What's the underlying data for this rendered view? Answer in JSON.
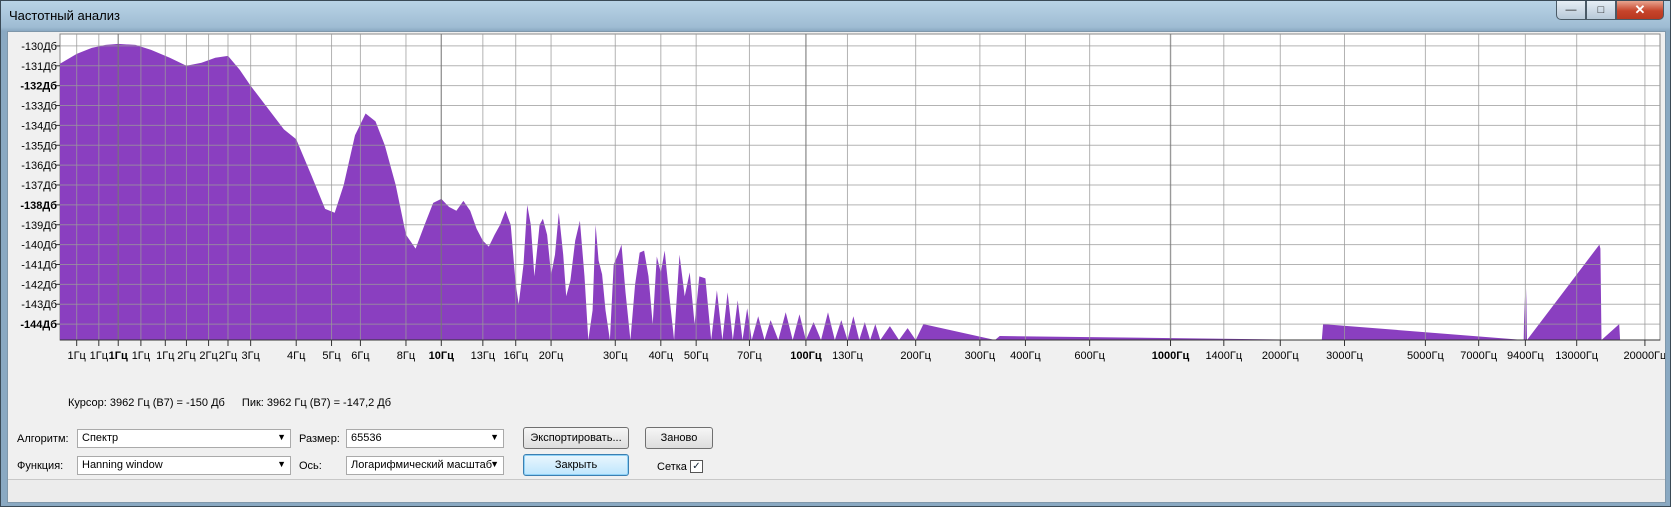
{
  "window": {
    "title": "Частотный анализ",
    "close_glyph": "✕",
    "min_glyph": "—",
    "max_glyph": "□"
  },
  "chart_data": {
    "type": "area",
    "fill_color": "#8a3fc0",
    "grid": true,
    "x_scale": "log",
    "xlim": [
      0.9,
      22000
    ],
    "ylim": [
      -144.8,
      -129.4
    ],
    "y_ticks": [
      {
        "v": -130,
        "label": "-130Дб",
        "bold": false
      },
      {
        "v": -131,
        "label": "-131Дб",
        "bold": false
      },
      {
        "v": -132,
        "label": "-132Дб",
        "bold": true
      },
      {
        "v": -133,
        "label": "-133Дб",
        "bold": false
      },
      {
        "v": -134,
        "label": "-134Дб",
        "bold": false
      },
      {
        "v": -135,
        "label": "-135Дб",
        "bold": false
      },
      {
        "v": -136,
        "label": "-136Дб",
        "bold": false
      },
      {
        "v": -137,
        "label": "-137Дб",
        "bold": false
      },
      {
        "v": -138,
        "label": "-138Дб",
        "bold": true
      },
      {
        "v": -139,
        "label": "-139Дб",
        "bold": false
      },
      {
        "v": -140,
        "label": "-140Дб",
        "bold": false
      },
      {
        "v": -141,
        "label": "-141Дб",
        "bold": false
      },
      {
        "v": -142,
        "label": "-142Дб",
        "bold": false
      },
      {
        "v": -143,
        "label": "-143Дб",
        "bold": false
      },
      {
        "v": -144,
        "label": "-144Дб",
        "bold": true
      }
    ],
    "x_ticks": [
      {
        "v": 1,
        "label": "1Гц",
        "bold": false
      },
      {
        "v": 1.15,
        "label": "1Гц",
        "bold": false
      },
      {
        "v": 1.3,
        "label": "1Гц",
        "bold": true
      },
      {
        "v": 1.5,
        "label": "1Гц",
        "bold": false
      },
      {
        "v": 1.75,
        "label": "1Гц",
        "bold": false
      },
      {
        "v": 2,
        "label": "2Гц",
        "bold": false
      },
      {
        "v": 2.3,
        "label": "2Гц",
        "bold": false
      },
      {
        "v": 2.6,
        "label": "2Гц",
        "bold": false
      },
      {
        "v": 3,
        "label": "3Гц",
        "bold": false
      },
      {
        "v": 4,
        "label": "4Гц",
        "bold": false
      },
      {
        "v": 5,
        "label": "5Гц",
        "bold": false
      },
      {
        "v": 6,
        "label": "6Гц",
        "bold": false
      },
      {
        "v": 8,
        "label": "8Гц",
        "bold": false
      },
      {
        "v": 10,
        "label": "10Гц",
        "bold": true
      },
      {
        "v": 13,
        "label": "13Гц",
        "bold": false
      },
      {
        "v": 16,
        "label": "16Гц",
        "bold": false
      },
      {
        "v": 20,
        "label": "20Гц",
        "bold": false
      },
      {
        "v": 30,
        "label": "30Гц",
        "bold": false
      },
      {
        "v": 40,
        "label": "40Гц",
        "bold": false
      },
      {
        "v": 50,
        "label": "50Гц",
        "bold": false
      },
      {
        "v": 70,
        "label": "70Гц",
        "bold": false
      },
      {
        "v": 100,
        "label": "100Гц",
        "bold": true
      },
      {
        "v": 130,
        "label": "130Гц",
        "bold": false
      },
      {
        "v": 200,
        "label": "200Гц",
        "bold": false
      },
      {
        "v": 300,
        "label": "300Гц",
        "bold": false
      },
      {
        "v": 400,
        "label": "400Гц",
        "bold": false
      },
      {
        "v": 600,
        "label": "600Гц",
        "bold": false
      },
      {
        "v": 1000,
        "label": "1000Гц",
        "bold": true
      },
      {
        "v": 1400,
        "label": "1400Гц",
        "bold": false
      },
      {
        "v": 2000,
        "label": "2000Гц",
        "bold": false
      },
      {
        "v": 3000,
        "label": "3000Гц",
        "bold": false
      },
      {
        "v": 5000,
        "label": "5000Гц",
        "bold": false
      },
      {
        "v": 7000,
        "label": "7000Гц",
        "bold": false
      },
      {
        "v": 9400,
        "label": "9400Гц",
        "bold": false
      },
      {
        "v": 13000,
        "label": "13000Гц",
        "bold": false
      },
      {
        "v": 20000,
        "label": "20000Гц",
        "bold": false
      }
    ],
    "series": [
      {
        "x": [
          0.9,
          1.0,
          1.1,
          1.2,
          1.3,
          1.45,
          1.6,
          1.8,
          2.0,
          2.2,
          2.4,
          2.6,
          2.8,
          3.0,
          3.3,
          3.7,
          4.0,
          4.4,
          4.8,
          5.1,
          5.4,
          5.8,
          6.2,
          6.6,
          7.0,
          7.5,
          8.0,
          8.5,
          9.0,
          9.5,
          10.0,
          10.5,
          11.0,
          11.5,
          12.0,
          12.5,
          13.0,
          13.5,
          14.0,
          14.5,
          15.0,
          15.5,
          16.0,
          16.3,
          16.8,
          17.2,
          17.6,
          18.0,
          18.6,
          19.0,
          19.5,
          20.0,
          20.5,
          21.0,
          21.6,
          22.0,
          22.6,
          23.3,
          24.0,
          24.7,
          25.3,
          26.0,
          26.5,
          27.0,
          27.6,
          28.2,
          29.0,
          29.7,
          30.5,
          31.2,
          32.0,
          33.0,
          34.0,
          35.0,
          36.0,
          37.0,
          38.0,
          39.0,
          40.0,
          41.0,
          42.0,
          43.5,
          45.0,
          46.5,
          48.0,
          49.5,
          51.0,
          53.0,
          55.0,
          57.0,
          59.0,
          61.0,
          63.0,
          65.0,
          67.0,
          69.0,
          71.0,
          74.0,
          77.0,
          80.0,
          84.0,
          88.0,
          92.0,
          96.0,
          100,
          105,
          110,
          115,
          120,
          125,
          130,
          135,
          140,
          145,
          150,
          155,
          160,
          170,
          180,
          190,
          200,
          210,
          330,
          340,
          2600,
          2620,
          9300,
          9350,
          9400,
          9450,
          9500,
          15000,
          15100,
          15200,
          17000,
          17100
        ],
        "y": [
          -130.9,
          -130.4,
          -130.1,
          -129.95,
          -129.9,
          -129.95,
          -130.2,
          -130.6,
          -131.0,
          -130.85,
          -130.6,
          -130.5,
          -131.2,
          -132.0,
          -133.0,
          -134.2,
          -134.7,
          -136.5,
          -138.2,
          -138.4,
          -137.0,
          -134.5,
          -133.4,
          -133.8,
          -135.0,
          -137.0,
          -139.5,
          -140.2,
          -139.0,
          -137.9,
          -137.7,
          -138.1,
          -138.3,
          -137.8,
          -138.3,
          -139.2,
          -139.8,
          -140.1,
          -139.5,
          -139.0,
          -138.3,
          -139.0,
          -142.0,
          -143.0,
          -141.0,
          -138.0,
          -139.0,
          -141.6,
          -139.0,
          -138.7,
          -139.5,
          -141.5,
          -140.5,
          -138.4,
          -140.5,
          -142.6,
          -141.8,
          -139.8,
          -138.8,
          -141.6,
          -144.8,
          -143.3,
          -139.0,
          -140.8,
          -141.5,
          -143.3,
          -144.8,
          -141.0,
          -140.5,
          -140.0,
          -142.4,
          -144.8,
          -142.0,
          -140.4,
          -140.3,
          -141.6,
          -144.0,
          -140.6,
          -141.4,
          -140.3,
          -142.2,
          -144.8,
          -140.5,
          -142.6,
          -141.4,
          -144.0,
          -141.6,
          -141.7,
          -144.8,
          -142.3,
          -144.8,
          -142.4,
          -144.8,
          -142.8,
          -144.8,
          -143.2,
          -144.8,
          -143.6,
          -144.8,
          -143.8,
          -144.8,
          -143.4,
          -144.8,
          -143.5,
          -144.8,
          -143.9,
          -144.8,
          -143.4,
          -144.8,
          -143.8,
          -144.8,
          -143.6,
          -144.8,
          -143.9,
          -144.8,
          -144.0,
          -144.8,
          -144.1,
          -144.8,
          -144.2,
          -144.8,
          -144.0,
          -144.8,
          -144.6,
          -144.8,
          -144.0,
          -144.8,
          -142.6,
          -144.8,
          -142.2,
          -144.8,
          -140.0,
          -140.2,
          -144.8,
          -144.0,
          -144.8
        ]
      }
    ]
  },
  "status": {
    "cursor": "Курсор: 3962 Гц (B7) = -150 Дб",
    "peak": "Пик: 3962 Гц (B7) = -147,2 Дб"
  },
  "controls": {
    "algorithm_label": "Алгоритм:",
    "algorithm_value": "Спектр",
    "function_label": "Функция:",
    "function_value": "Hanning window",
    "size_label": "Размер:",
    "size_value": "65536",
    "axis_label": "Ось:",
    "axis_value": "Логарифмический масштаб",
    "export_button": "Экспортировать...",
    "replot_button": "Заново",
    "close_button": "Закрыть",
    "grid_label": "Сетка",
    "grid_checked": true,
    "check_glyph": "✓",
    "dropdown_glyph": "▼"
  }
}
